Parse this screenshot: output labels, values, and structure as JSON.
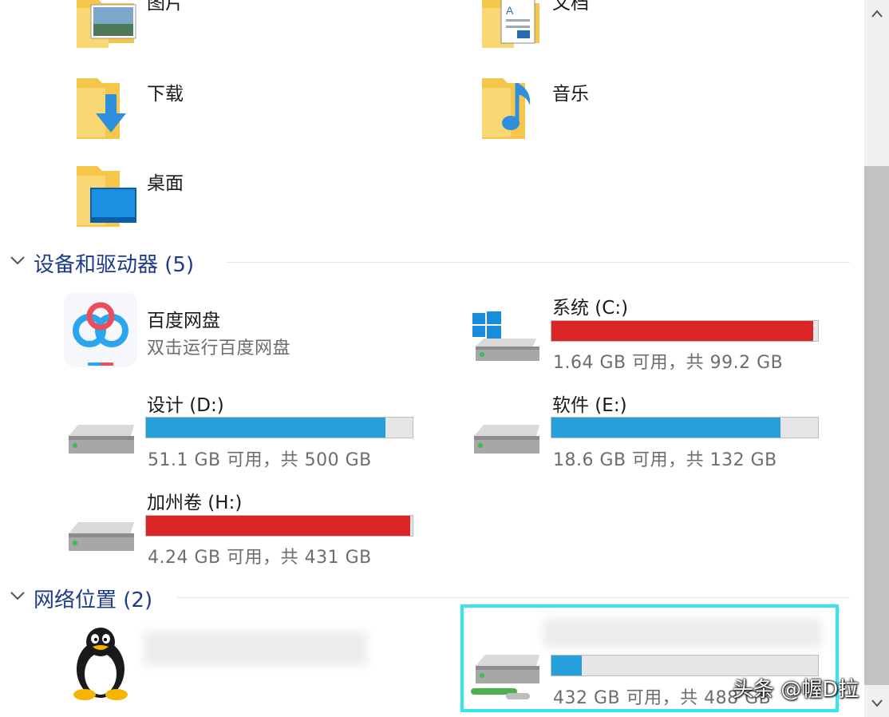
{
  "folders": [
    {
      "label": "图片",
      "icon": "pictures-folder-icon"
    },
    {
      "label": "文档",
      "icon": "documents-folder-icon"
    },
    {
      "label": "下载",
      "icon": "downloads-folder-icon"
    },
    {
      "label": "音乐",
      "icon": "music-folder-icon"
    },
    {
      "label": "桌面",
      "icon": "desktop-folder-icon"
    }
  ],
  "devices_section": {
    "title": "设备和驱动器 (5)"
  },
  "baidu": {
    "name": "百度网盘",
    "subtitle": "双击运行百度网盘"
  },
  "drives": [
    {
      "name": "系统 (C:)",
      "free_text": "1.64 GB 可用，共 99.2 GB",
      "used_fraction": 0.983,
      "bar_color": "#da2626"
    },
    {
      "name": "设计 (D:)",
      "free_text": "51.1 GB 可用，共 500 GB",
      "used_fraction": 0.898,
      "bar_color": "#26a0da"
    },
    {
      "name": "软件 (E:)",
      "free_text": "18.6 GB 可用，共 132 GB",
      "used_fraction": 0.859,
      "bar_color": "#26a0da"
    },
    {
      "name": "加州卷 (H:)",
      "free_text": "4.24 GB 可用，共 431 GB",
      "used_fraction": 0.99,
      "bar_color": "#da2626"
    }
  ],
  "network_section": {
    "title": "网络位置 (2)"
  },
  "network_drive": {
    "free_text": "432 GB 可用，共 488 GB",
    "used_fraction": 0.115,
    "bar_color": "#26a0da"
  },
  "watermark": "头条 @幄D拉",
  "colors": {
    "selection": "#33e6f0",
    "section_title": "#1e3a8a"
  }
}
